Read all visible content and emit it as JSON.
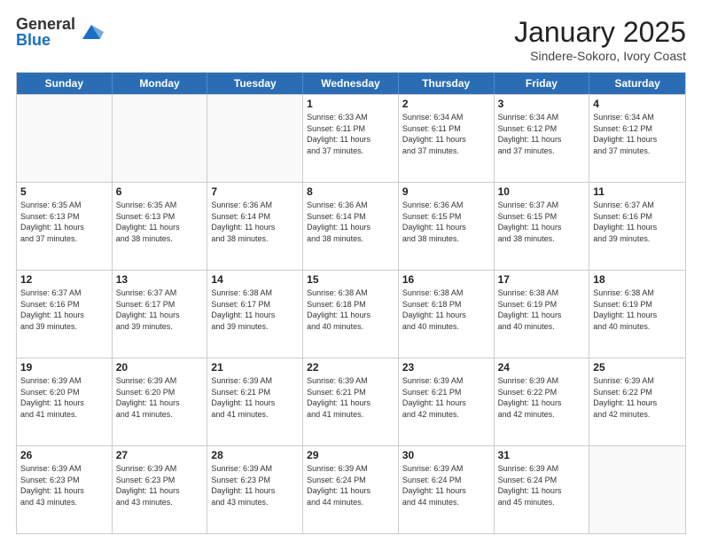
{
  "logo": {
    "general": "General",
    "blue": "Blue"
  },
  "header": {
    "month": "January 2025",
    "location": "Sindere-Sokoro, Ivory Coast"
  },
  "weekdays": [
    "Sunday",
    "Monday",
    "Tuesday",
    "Wednesday",
    "Thursday",
    "Friday",
    "Saturday"
  ],
  "weeks": [
    [
      {
        "day": "",
        "info": "",
        "empty": true
      },
      {
        "day": "",
        "info": "",
        "empty": true
      },
      {
        "day": "",
        "info": "",
        "empty": true
      },
      {
        "day": "1",
        "info": "Sunrise: 6:33 AM\nSunset: 6:11 PM\nDaylight: 11 hours\nand 37 minutes."
      },
      {
        "day": "2",
        "info": "Sunrise: 6:34 AM\nSunset: 6:11 PM\nDaylight: 11 hours\nand 37 minutes."
      },
      {
        "day": "3",
        "info": "Sunrise: 6:34 AM\nSunset: 6:12 PM\nDaylight: 11 hours\nand 37 minutes."
      },
      {
        "day": "4",
        "info": "Sunrise: 6:34 AM\nSunset: 6:12 PM\nDaylight: 11 hours\nand 37 minutes."
      }
    ],
    [
      {
        "day": "5",
        "info": "Sunrise: 6:35 AM\nSunset: 6:13 PM\nDaylight: 11 hours\nand 37 minutes."
      },
      {
        "day": "6",
        "info": "Sunrise: 6:35 AM\nSunset: 6:13 PM\nDaylight: 11 hours\nand 38 minutes."
      },
      {
        "day": "7",
        "info": "Sunrise: 6:36 AM\nSunset: 6:14 PM\nDaylight: 11 hours\nand 38 minutes."
      },
      {
        "day": "8",
        "info": "Sunrise: 6:36 AM\nSunset: 6:14 PM\nDaylight: 11 hours\nand 38 minutes."
      },
      {
        "day": "9",
        "info": "Sunrise: 6:36 AM\nSunset: 6:15 PM\nDaylight: 11 hours\nand 38 minutes."
      },
      {
        "day": "10",
        "info": "Sunrise: 6:37 AM\nSunset: 6:15 PM\nDaylight: 11 hours\nand 38 minutes."
      },
      {
        "day": "11",
        "info": "Sunrise: 6:37 AM\nSunset: 6:16 PM\nDaylight: 11 hours\nand 39 minutes."
      }
    ],
    [
      {
        "day": "12",
        "info": "Sunrise: 6:37 AM\nSunset: 6:16 PM\nDaylight: 11 hours\nand 39 minutes."
      },
      {
        "day": "13",
        "info": "Sunrise: 6:37 AM\nSunset: 6:17 PM\nDaylight: 11 hours\nand 39 minutes."
      },
      {
        "day": "14",
        "info": "Sunrise: 6:38 AM\nSunset: 6:17 PM\nDaylight: 11 hours\nand 39 minutes."
      },
      {
        "day": "15",
        "info": "Sunrise: 6:38 AM\nSunset: 6:18 PM\nDaylight: 11 hours\nand 40 minutes."
      },
      {
        "day": "16",
        "info": "Sunrise: 6:38 AM\nSunset: 6:18 PM\nDaylight: 11 hours\nand 40 minutes."
      },
      {
        "day": "17",
        "info": "Sunrise: 6:38 AM\nSunset: 6:19 PM\nDaylight: 11 hours\nand 40 minutes."
      },
      {
        "day": "18",
        "info": "Sunrise: 6:38 AM\nSunset: 6:19 PM\nDaylight: 11 hours\nand 40 minutes."
      }
    ],
    [
      {
        "day": "19",
        "info": "Sunrise: 6:39 AM\nSunset: 6:20 PM\nDaylight: 11 hours\nand 41 minutes."
      },
      {
        "day": "20",
        "info": "Sunrise: 6:39 AM\nSunset: 6:20 PM\nDaylight: 11 hours\nand 41 minutes."
      },
      {
        "day": "21",
        "info": "Sunrise: 6:39 AM\nSunset: 6:21 PM\nDaylight: 11 hours\nand 41 minutes."
      },
      {
        "day": "22",
        "info": "Sunrise: 6:39 AM\nSunset: 6:21 PM\nDaylight: 11 hours\nand 41 minutes."
      },
      {
        "day": "23",
        "info": "Sunrise: 6:39 AM\nSunset: 6:21 PM\nDaylight: 11 hours\nand 42 minutes."
      },
      {
        "day": "24",
        "info": "Sunrise: 6:39 AM\nSunset: 6:22 PM\nDaylight: 11 hours\nand 42 minutes."
      },
      {
        "day": "25",
        "info": "Sunrise: 6:39 AM\nSunset: 6:22 PM\nDaylight: 11 hours\nand 42 minutes."
      }
    ],
    [
      {
        "day": "26",
        "info": "Sunrise: 6:39 AM\nSunset: 6:23 PM\nDaylight: 11 hours\nand 43 minutes."
      },
      {
        "day": "27",
        "info": "Sunrise: 6:39 AM\nSunset: 6:23 PM\nDaylight: 11 hours\nand 43 minutes."
      },
      {
        "day": "28",
        "info": "Sunrise: 6:39 AM\nSunset: 6:23 PM\nDaylight: 11 hours\nand 43 minutes."
      },
      {
        "day": "29",
        "info": "Sunrise: 6:39 AM\nSunset: 6:24 PM\nDaylight: 11 hours\nand 44 minutes."
      },
      {
        "day": "30",
        "info": "Sunrise: 6:39 AM\nSunset: 6:24 PM\nDaylight: 11 hours\nand 44 minutes."
      },
      {
        "day": "31",
        "info": "Sunrise: 6:39 AM\nSunset: 6:24 PM\nDaylight: 11 hours\nand 45 minutes."
      },
      {
        "day": "",
        "info": "",
        "empty": true
      }
    ]
  ]
}
